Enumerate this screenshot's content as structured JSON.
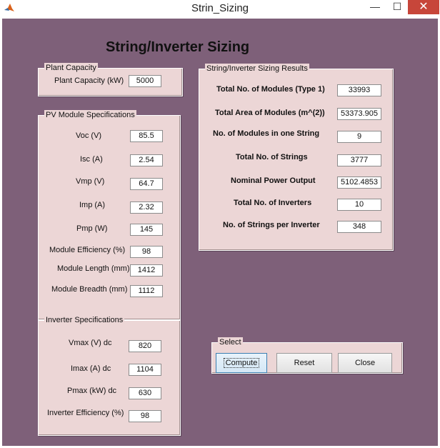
{
  "window": {
    "title": "Strin_Sizing",
    "controls": {
      "minimize": "—",
      "maximize": "☐",
      "close": "✕"
    }
  },
  "main_title": "String/Inverter Sizing",
  "plant_capacity": {
    "title": "Plant Capacity",
    "fields": [
      {
        "label": "Plant Capacity (kW)",
        "value": "5000"
      }
    ]
  },
  "pv_module": {
    "title": "PV Module Specifications",
    "fields": [
      {
        "label": "Voc (V)",
        "value": "85.5"
      },
      {
        "label": "Isc (A)",
        "value": "2.54"
      },
      {
        "label": "Vmp (V)",
        "value": "64.7"
      },
      {
        "label": "Imp (A)",
        "value": "2.32"
      },
      {
        "label": "Pmp (W)",
        "value": "145"
      },
      {
        "label": "Module Efficiency (%)",
        "value": "98"
      },
      {
        "label": "Module Length (mm)",
        "value": "1412"
      },
      {
        "label": "Module Breadth (mm)",
        "value": "1112"
      }
    ]
  },
  "inverter": {
    "title": "Inverter Specifications",
    "fields": [
      {
        "label": "Vmax (V) dc",
        "value": "820"
      },
      {
        "label": "Imax (A) dc",
        "value": "1104"
      },
      {
        "label": "Pmax (kW) dc",
        "value": "630"
      },
      {
        "label": "Inverter Efficiency (%)",
        "value": "98"
      }
    ]
  },
  "results": {
    "title": "String/Inverter Sizing Results",
    "fields": [
      {
        "label": "Total No. of Modules (Type 1)",
        "value": "33993"
      },
      {
        "label": "Total Area of Modules (m^(2))",
        "value": "53373.905"
      },
      {
        "label": "No. of Modules in one String",
        "value": "9"
      },
      {
        "label": "Total No. of Strings",
        "value": "3777"
      },
      {
        "label": "Nominal Power Output",
        "value": "5102.4853"
      },
      {
        "label": "Total No. of Inverters",
        "value": "10"
      },
      {
        "label": "No. of Strings per Inverter",
        "value": "348"
      }
    ]
  },
  "select": {
    "title": "Select",
    "buttons": {
      "compute": "Compute",
      "reset": "Reset",
      "close": "Close"
    }
  }
}
